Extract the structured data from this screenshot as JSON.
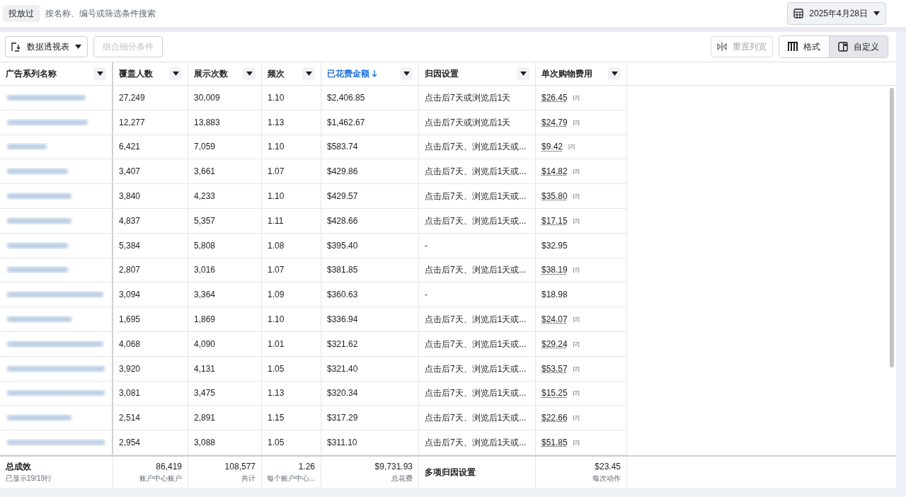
{
  "filter_chip": "投放过",
  "search": {
    "placeholder": "按名称、编号或筛选条件搜索"
  },
  "date_button": "2025年4月28日",
  "toolbar": {
    "pivot_button": "数据透视表",
    "breakdown_button": {
      "label": "组合细分条件",
      "disabled": true
    },
    "reset_button": {
      "label": "重置列宽",
      "disabled": true
    },
    "view_toggle": [
      {
        "label": "格式",
        "selected": false,
        "kind": "bars"
      },
      {
        "label": "自定义",
        "selected": true,
        "kind": "panel"
      }
    ]
  },
  "table": {
    "columns": [
      {
        "label": "广告系列名称",
        "sorted": false
      },
      {
        "label": "覆盖人数",
        "sorted": false
      },
      {
        "label": "展示次数",
        "sorted": false
      },
      {
        "label": "频次",
        "sorted": false
      },
      {
        "label": "已花费金额",
        "sorted": true
      },
      {
        "label": "归因设置",
        "sorted": false
      },
      {
        "label": "单次购物费用",
        "sorted": false
      }
    ],
    "rows": [
      {
        "reach": "27,249",
        "impressions": "30,009",
        "frequency": "1.10",
        "spent": "$2,406.85",
        "attribution": "点击后7天或浏览后1天",
        "cost": "$26.45",
        "note": "[2]"
      },
      {
        "reach": "12,277",
        "impressions": "13,883",
        "frequency": "1.13",
        "spent": "$1,462.67",
        "attribution": "点击后7天或浏览后1天",
        "cost": "$24.79",
        "note": "[2]"
      },
      {
        "reach": "6,421",
        "impressions": "7,059",
        "frequency": "1.10",
        "spent": "$583.74",
        "attribution": "点击后7天、浏览后1天或...",
        "cost": "$9.42",
        "note": "[2]"
      },
      {
        "reach": "3,407",
        "impressions": "3,661",
        "frequency": "1.07",
        "spent": "$429.86",
        "attribution": "点击后7天、浏览后1天或...",
        "cost": "$14.82",
        "note": "[2]"
      },
      {
        "reach": "3,840",
        "impressions": "4,233",
        "frequency": "1.10",
        "spent": "$429.57",
        "attribution": "点击后7天、浏览后1天或...",
        "cost": "$35.80",
        "note": "[2]"
      },
      {
        "reach": "4,837",
        "impressions": "5,357",
        "frequency": "1.11",
        "spent": "$428.66",
        "attribution": "点击后7天、浏览后1天或...",
        "cost": "$17.15",
        "note": "[2]"
      },
      {
        "reach": "5,384",
        "impressions": "5,808",
        "frequency": "1.08",
        "spent": "$395.40",
        "attribution": "-",
        "cost": "$32.95"
      },
      {
        "reach": "2,807",
        "impressions": "3,016",
        "frequency": "1.07",
        "spent": "$381.85",
        "attribution": "点击后7天、浏览后1天或...",
        "cost": "$38.19",
        "note": "[2]"
      },
      {
        "reach": "3,094",
        "impressions": "3,364",
        "frequency": "1.09",
        "spent": "$360.63",
        "attribution": "-",
        "cost": "$18.98"
      },
      {
        "reach": "1,695",
        "impressions": "1,869",
        "frequency": "1.10",
        "spent": "$336.94",
        "attribution": "点击后7天、浏览后1天或...",
        "cost": "$24.07",
        "note": "[2]"
      },
      {
        "reach": "4,068",
        "impressions": "4,090",
        "frequency": "1.01",
        "spent": "$321.62",
        "attribution": "点击后7天、浏览后1天或...",
        "cost": "$29.24",
        "note": "[2]"
      },
      {
        "reach": "3,920",
        "impressions": "4,131",
        "frequency": "1.05",
        "spent": "$321.40",
        "attribution": "点击后7天、浏览后1天或...",
        "cost": "$53.57",
        "note": "[2]"
      },
      {
        "reach": "3,081",
        "impressions": "3,475",
        "frequency": "1.13",
        "spent": "$320.34",
        "attribution": "点击后7天、浏览后1天或...",
        "cost": "$15.25",
        "note": "[2]"
      },
      {
        "reach": "2,514",
        "impressions": "2,891",
        "frequency": "1.15",
        "spent": "$317.29",
        "attribution": "点击后7天、浏览后1天或...",
        "cost": "$22.66",
        "note": "[2]"
      },
      {
        "reach": "2,954",
        "impressions": "3,088",
        "frequency": "1.05",
        "spent": "$311.10",
        "attribution": "点击后7天、浏览后1天或...",
        "cost": "$51.85",
        "note": "[2]"
      }
    ],
    "totals": {
      "title": "总成效",
      "subtitle": "已显示19/19行",
      "reach": {
        "value": "86,419",
        "caption": "账户中心账户"
      },
      "impressions": {
        "value": "108,577",
        "caption": "共计"
      },
      "frequency": {
        "value": "1.26",
        "caption": "每个账户中心..."
      },
      "spent": {
        "value": "$9,731.93",
        "caption": "总花费"
      },
      "attribution": "多项归因设置",
      "cost": {
        "value": "$23.45",
        "caption": "每次动作"
      }
    }
  }
}
